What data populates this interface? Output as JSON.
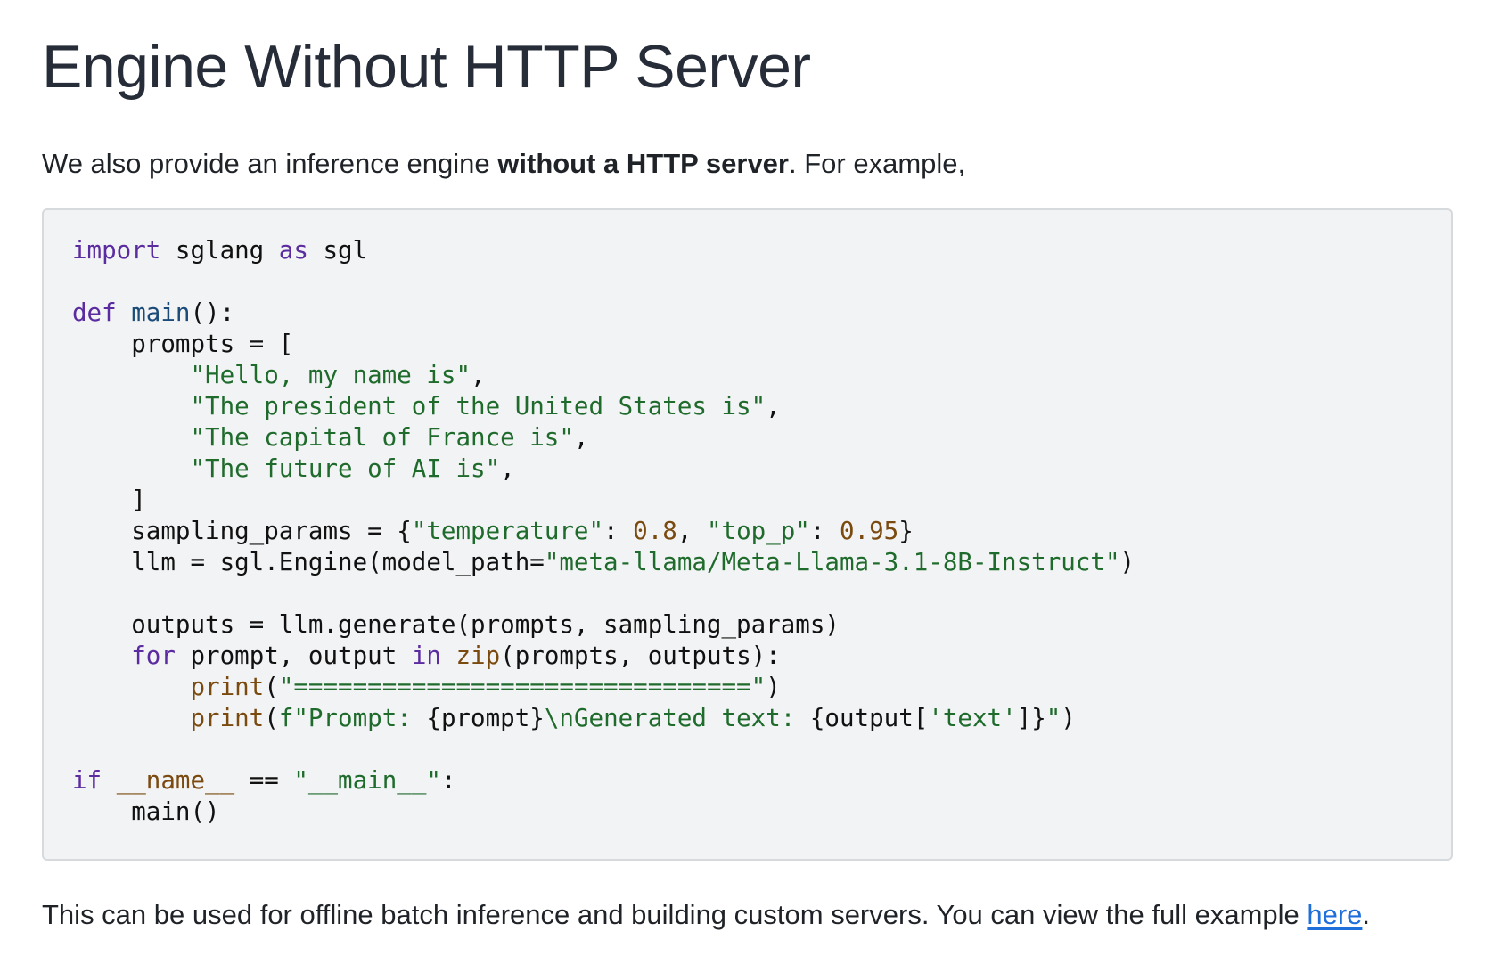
{
  "heading": "Engine Without HTTP Server",
  "intro": {
    "prefix": "We also provide an inference engine ",
    "bold": "without a HTTP server",
    "suffix": ". For example,"
  },
  "code": {
    "language": "python",
    "lines": [
      [
        [
          "kw",
          "import"
        ],
        [
          "t",
          " sglang "
        ],
        [
          "kw",
          "as"
        ],
        [
          "t",
          " sgl"
        ]
      ],
      [],
      [
        [
          "kw",
          "def"
        ],
        [
          "t",
          " "
        ],
        [
          "fn",
          "main"
        ],
        [
          "t",
          "():"
        ]
      ],
      [
        [
          "t",
          "    prompts = ["
        ]
      ],
      [
        [
          "t",
          "        "
        ],
        [
          "st",
          "\"Hello, my name is\""
        ],
        [
          "t",
          ","
        ]
      ],
      [
        [
          "t",
          "        "
        ],
        [
          "st",
          "\"The president of the United States is\""
        ],
        [
          "t",
          ","
        ]
      ],
      [
        [
          "t",
          "        "
        ],
        [
          "st",
          "\"The capital of France is\""
        ],
        [
          "t",
          ","
        ]
      ],
      [
        [
          "t",
          "        "
        ],
        [
          "st",
          "\"The future of AI is\""
        ],
        [
          "t",
          ","
        ]
      ],
      [
        [
          "t",
          "    ]"
        ]
      ],
      [
        [
          "t",
          "    sampling_params = {"
        ],
        [
          "st",
          "\"temperature\""
        ],
        [
          "t",
          ": "
        ],
        [
          "nm",
          "0.8"
        ],
        [
          "t",
          ", "
        ],
        [
          "st",
          "\"top_p\""
        ],
        [
          "t",
          ": "
        ],
        [
          "nm",
          "0.95"
        ],
        [
          "t",
          "}"
        ]
      ],
      [
        [
          "t",
          "    llm = sgl.Engine(model_path="
        ],
        [
          "st",
          "\"meta-llama/Meta-Llama-3.1-8B-Instruct\""
        ],
        [
          "t",
          ")"
        ]
      ],
      [],
      [
        [
          "t",
          "    outputs = llm.generate(prompts, sampling_params)"
        ]
      ],
      [
        [
          "t",
          "    "
        ],
        [
          "kw",
          "for"
        ],
        [
          "t",
          " prompt, output "
        ],
        [
          "kw",
          "in"
        ],
        [
          "t",
          " "
        ],
        [
          "bi",
          "zip"
        ],
        [
          "t",
          "(prompts, outputs):"
        ]
      ],
      [
        [
          "t",
          "        "
        ],
        [
          "bi",
          "print"
        ],
        [
          "t",
          "("
        ],
        [
          "st",
          "\"===============================\""
        ],
        [
          "t",
          ")"
        ]
      ],
      [
        [
          "t",
          "        "
        ],
        [
          "bi",
          "print"
        ],
        [
          "t",
          "("
        ],
        [
          "st",
          "f\"Prompt: "
        ],
        [
          "t",
          "{prompt}"
        ],
        [
          "st",
          "\\nGenerated text: "
        ],
        [
          "t",
          "{output["
        ],
        [
          "st",
          "'text'"
        ],
        [
          "t",
          "]}"
        ],
        [
          "st",
          "\""
        ],
        [
          "t",
          ")"
        ]
      ],
      [],
      [
        [
          "kw",
          "if"
        ],
        [
          "t",
          " "
        ],
        [
          "bi",
          "__name__"
        ],
        [
          "t",
          " == "
        ],
        [
          "st",
          "\"__main__\""
        ],
        [
          "t",
          ":"
        ]
      ],
      [
        [
          "t",
          "    main()"
        ]
      ]
    ]
  },
  "outro": {
    "text": "This can be used for offline batch inference and building custom servers. You can view the full example ",
    "link_label": "here",
    "suffix": "."
  }
}
